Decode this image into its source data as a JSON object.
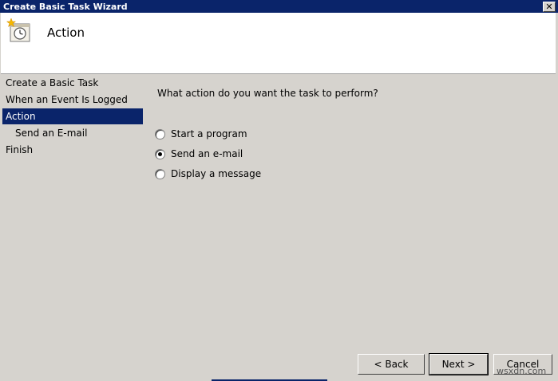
{
  "window": {
    "title": "Create Basic Task Wizard",
    "close_glyph": "✕"
  },
  "header": {
    "heading": "Action",
    "icon": "clock-task-icon"
  },
  "nav": {
    "items": [
      {
        "label": "Create a Basic Task",
        "selected": false,
        "sub": false
      },
      {
        "label": "When an Event Is Logged",
        "selected": false,
        "sub": false
      },
      {
        "label": "Action",
        "selected": true,
        "sub": false
      },
      {
        "label": "Send an E-mail",
        "selected": false,
        "sub": true
      },
      {
        "label": "Finish",
        "selected": false,
        "sub": false
      }
    ]
  },
  "main": {
    "question": "What action do you want the task to perform?",
    "options": [
      {
        "label": "Start a program",
        "checked": false
      },
      {
        "label": "Send an e-mail",
        "checked": true
      },
      {
        "label": "Display a message",
        "checked": false
      }
    ]
  },
  "buttons": {
    "back": "< Back",
    "next": "Next >",
    "cancel": "Cancel"
  },
  "watermark": "wsxdn.com",
  "colors": {
    "titlebar": "#0a246a",
    "selection": "#0a246a",
    "dialog_bg": "#d6d3ce"
  }
}
